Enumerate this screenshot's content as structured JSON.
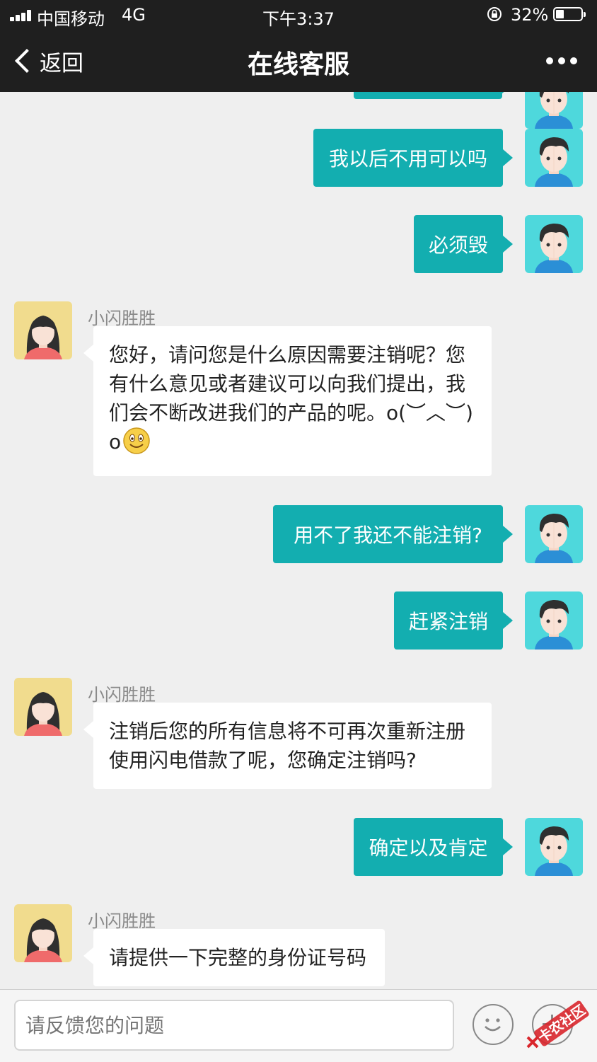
{
  "status_bar": {
    "carrier": "中国移动",
    "network": "4G",
    "time": "下午3:37",
    "battery_pct": "32%",
    "battery_level": 0.32
  },
  "nav": {
    "back_label": "返回",
    "title": "在线客服",
    "more_icon": "more-dots-icon"
  },
  "agent_name": "小闪胜胜",
  "messages": [
    {
      "side": "out",
      "text": "我以后不用可以吗"
    },
    {
      "side": "out",
      "text": "必须毁"
    },
    {
      "side": "in",
      "sender": "小闪胜胜",
      "lines": [
        "您好，请问您是什么原因需要注销呢？您",
        "有什么意见或者建议可以向我们提出，我",
        "们会不断改进我们的产品的呢。o(︶︿︶)",
        "o"
      ]
    },
    {
      "side": "out",
      "text": "用不了我还不能注销?"
    },
    {
      "side": "out",
      "text": "赶紧注销"
    },
    {
      "side": "in",
      "sender": "小闪胜胜",
      "lines": [
        "注销后您的所有信息将不可再次重新注册",
        "使用闪电借款了呢，您确定注销吗?"
      ]
    },
    {
      "side": "out",
      "text": "确定以及肯定"
    },
    {
      "side": "in",
      "sender": "小闪胜胜",
      "lines": [
        "请提供一下完整的身份证号码"
      ]
    }
  ],
  "input": {
    "placeholder": "请反馈您的问题"
  },
  "watermark": {
    "text": "卡农社区"
  },
  "colors": {
    "accent": "#13aeb0",
    "nav_bg": "#1f1f1f",
    "chat_bg": "#efefef"
  }
}
